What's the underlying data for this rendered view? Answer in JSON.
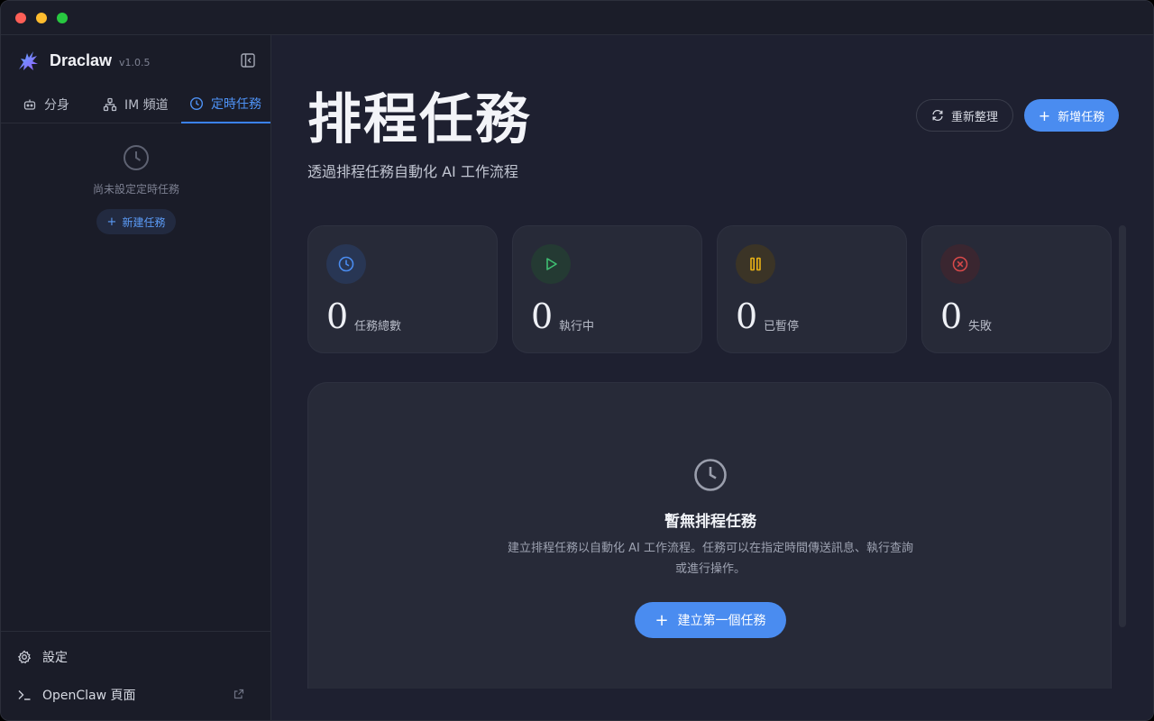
{
  "window": {
    "controls": [
      "close",
      "minimize",
      "zoom"
    ]
  },
  "sidebar": {
    "app_name": "Draclaw",
    "version": "v1.0.5",
    "tabs": [
      {
        "label": "分身",
        "icon": "robot-icon",
        "active": false
      },
      {
        "label": "IM 頻道",
        "icon": "network-icon",
        "active": false
      },
      {
        "label": "定時任務",
        "icon": "clock-icon",
        "active": true
      }
    ],
    "empty_text": "尚未設定定時任務",
    "new_button": "新建任務",
    "bottom": {
      "settings": "設定",
      "openclaw": "OpenClaw 頁面"
    }
  },
  "main": {
    "title": "排程任務",
    "subtitle": "透過排程任務自動化 AI 工作流程",
    "refresh_button": "重新整理",
    "new_task_button": "新增任務",
    "stats": [
      {
        "value": "0",
        "label": "任務總數",
        "icon": "clock-icon",
        "color": "#4a8cf0"
      },
      {
        "value": "0",
        "label": "執行中",
        "icon": "play-icon",
        "color": "#3fbf72"
      },
      {
        "value": "0",
        "label": "已暫停",
        "icon": "pause-icon",
        "color": "#e9b215"
      },
      {
        "value": "0",
        "label": "失敗",
        "icon": "x-circle-icon",
        "color": "#d94a4a"
      }
    ],
    "empty": {
      "title": "暫無排程任務",
      "description": "建立排程任務以自動化 AI 工作流程。任務可以在指定時間傳送訊息、執行查詢或進行操作。",
      "button": "建立第一個任務"
    }
  },
  "colors": {
    "accent": "#4a8cf0",
    "background": "#1e2030",
    "card": "#272a38"
  }
}
